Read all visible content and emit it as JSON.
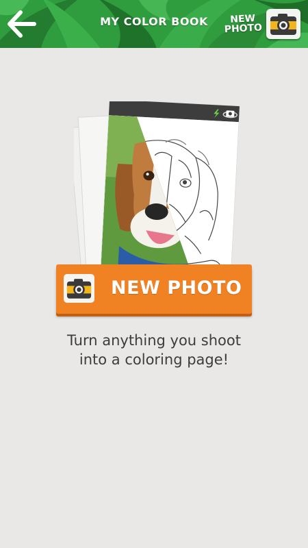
{
  "header": {
    "title": "MY COLOR BOOK",
    "new_photo_line1": "NEW",
    "new_photo_line2": "PHOTO"
  },
  "main": {
    "button_label": "NEW PHOTO",
    "tagline_line1": "Turn anything you shoot",
    "tagline_line2": "into a coloring page!"
  },
  "icons": {
    "back": "arrow-left-icon",
    "camera": "camera-icon",
    "flash": "flash-icon",
    "rotate_camera": "rotate-camera-icon"
  },
  "colors": {
    "header_green": "#2e9a3d",
    "button_orange": "#f08224",
    "camera_yellow": "#f3b51c",
    "background": "#e9e8e6"
  }
}
